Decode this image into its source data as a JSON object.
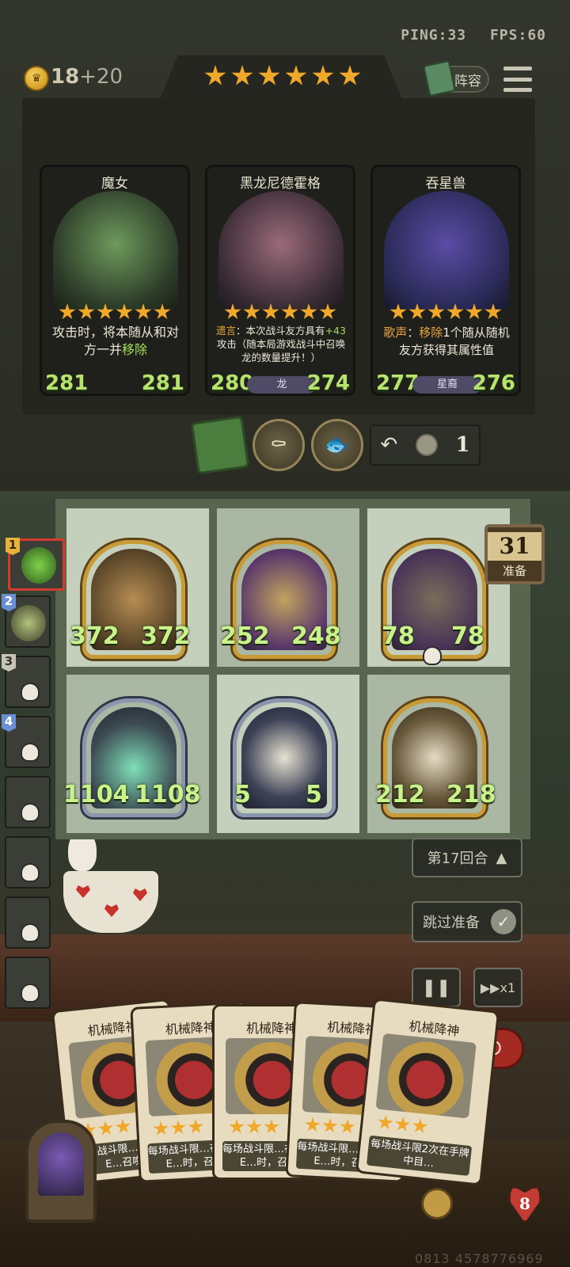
{
  "status": {
    "ping": "PING:33",
    "fps": "FPS:60"
  },
  "gold": {
    "amount": "18",
    "income": "+20"
  },
  "tavern": {
    "tier_stars": 6
  },
  "top_buttons": {
    "lineup_label": "阵容"
  },
  "shop": [
    {
      "name": "魔女",
      "stars": 6,
      "desc_parts": [
        "攻击时，将本随从和对方一并",
        "移除"
      ],
      "attack": "281",
      "health": "281",
      "tribe": ""
    },
    {
      "name": "黑龙尼德霍格",
      "stars": 6,
      "desc_prefix": "遗言",
      "desc_parts": [
        "：本次战斗友方具有",
        "+43",
        "攻击（随本局游戏战斗中召唤龙的数量提升！）"
      ],
      "attack": "280",
      "health": "274",
      "tribe": "龙"
    },
    {
      "name": "吞星兽",
      "stars": 6,
      "desc_prefix": "歌声",
      "desc_parts": [
        "：",
        "移除",
        "1个随从随机友方获得其属性值"
      ],
      "attack": "277",
      "health": "276",
      "tribe": "星裔"
    }
  ],
  "refresh": {
    "cost": "1"
  },
  "turn": {
    "number": "31",
    "label": "准备"
  },
  "players": [
    {
      "rank": "1",
      "self": true
    },
    {
      "rank": "2"
    },
    {
      "rank": "3"
    },
    {
      "rank": "4"
    },
    {
      "rank": ""
    },
    {
      "rank": ""
    },
    {
      "rank": ""
    },
    {
      "rank": ""
    }
  ],
  "board": [
    {
      "attack": "372",
      "health": "372",
      "frame": "gold"
    },
    {
      "attack": "252",
      "health": "248",
      "frame": "gold"
    },
    {
      "attack": "78",
      "health": "78",
      "frame": "gold"
    },
    {
      "attack": "1104",
      "health": "1108",
      "frame": "silver"
    },
    {
      "attack": "5",
      "health": "5",
      "frame": "silver"
    },
    {
      "attack": "212",
      "health": "218",
      "frame": "gold"
    }
  ],
  "controls": {
    "round_label": "第17回合",
    "skip_label": "跳过准备",
    "speed_label": "▶▶x1"
  },
  "hand": [
    {
      "name": "机械降神",
      "text": "每场战斗限…在手牌中E…召唤本"
    },
    {
      "name": "机械降神",
      "text": "每场战斗限…在手牌中E…时，召唤本"
    },
    {
      "name": "机械降神",
      "text": "每场战斗限…在手牌中E…时，召唤本"
    },
    {
      "name": "机械降神",
      "text": "每场战斗限…在手牌中E…时，召唤本"
    },
    {
      "name": "机械降神",
      "text": "每场战斗限2次在手牌中目…"
    }
  ],
  "hero": {
    "health": "8"
  },
  "footer": {
    "code": "0813 4578776969"
  },
  "colors": {
    "stat_green": "#b8e36c",
    "star": "#f0a82a",
    "highlight": "#a6dd5a",
    "accent_red": "#a52a22"
  }
}
